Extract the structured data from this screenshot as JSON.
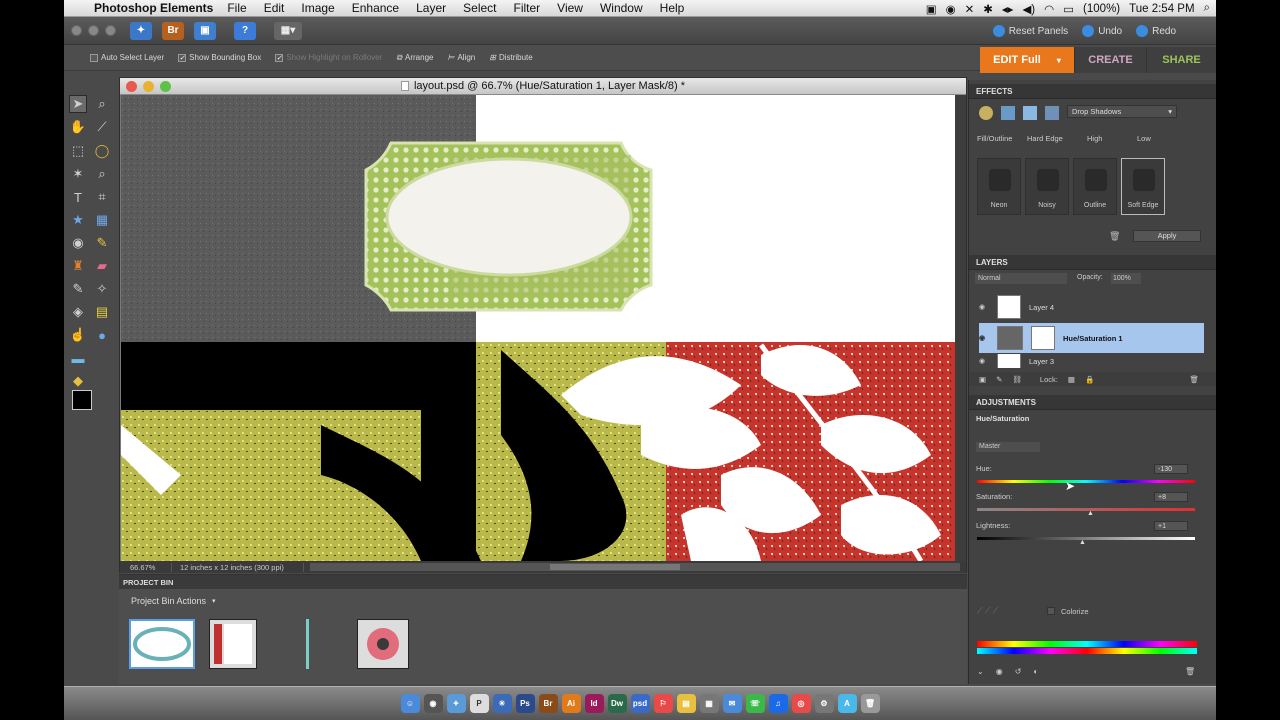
{
  "menubar": {
    "app_name": "Photoshop Elements",
    "items": [
      "File",
      "Edit",
      "Image",
      "Enhance",
      "Layer",
      "Select",
      "Filter",
      "View",
      "Window",
      "Help"
    ],
    "battery": "(100%)",
    "clock": "Tue 2:54 PM"
  },
  "topbar": {
    "reset_panels": "Reset Panels",
    "undo": "Undo",
    "redo": "Redo",
    "br_label": "Br",
    "help_label": "?"
  },
  "options": {
    "auto_select": "Auto Select Layer",
    "show_bounding": "Show Bounding Box",
    "show_highlight": "Show Highlight on Rollover",
    "arrange": "Arrange",
    "align": "Align",
    "distribute": "Distribute"
  },
  "modes": {
    "edit": "EDIT Full",
    "create": "CREATE",
    "share": "SHARE"
  },
  "document": {
    "title": "layout.psd @ 66.7% (Hue/Saturation 1, Layer Mask/8) *",
    "zoom": "66.67%",
    "dimensions": "12 inches x 12 inches (300 ppi)"
  },
  "project_bin": {
    "header": "PROJECT BIN",
    "actions": "Project Bin Actions"
  },
  "effects": {
    "header": "EFFECTS",
    "dropdown": "Drop Shadows",
    "tabs": [
      "Fill/Outline",
      "Hard Edge",
      "High",
      "Low"
    ],
    "swatches": [
      "Neon",
      "Noisy",
      "Outline",
      "Soft Edge"
    ],
    "apply": "Apply"
  },
  "layers": {
    "header": "LAYERS",
    "blend": "Normal",
    "opacity_label": "Opacity:",
    "opacity": "100%",
    "rows": [
      {
        "name": "Layer 4"
      },
      {
        "name": "Hue/Saturation 1"
      },
      {
        "name": "Layer 3"
      }
    ],
    "lock_label": "Lock:"
  },
  "adjustments": {
    "header": "ADJUSTMENTS",
    "title": "Hue/Saturation",
    "channel": "Master",
    "hue_label": "Hue:",
    "hue": "-130",
    "sat_label": "Saturation:",
    "sat": "+8",
    "light_label": "Lightness:",
    "light": "+1",
    "colorize": "Colorize"
  },
  "dock": {
    "labels": [
      "Ps",
      "Br",
      "Ai",
      "Id",
      "Dw",
      "psd"
    ]
  },
  "colors": {
    "edit_mode": "#e9781c",
    "selected_layer": "#a7c6ee",
    "hue_rainbow": "#ff0000"
  }
}
